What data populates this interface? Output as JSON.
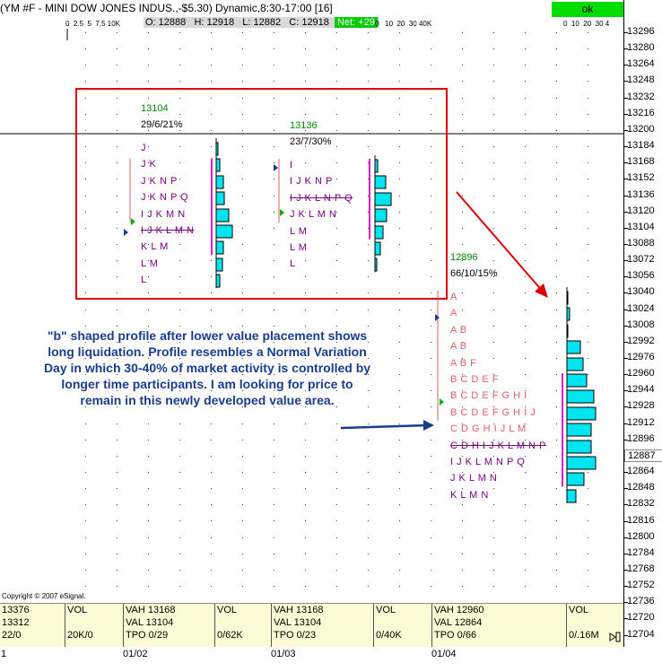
{
  "window": {
    "title": "(YM #F - MINI DOW JONES INDUS.,-$5.30) Dynamic,8:30-17:00 [16]",
    "ok_label": "ok"
  },
  "quote_bar": {
    "open": "O: 12888",
    "high": "H: 12918",
    "low": "L: 12882",
    "close": "C: 12918",
    "net": "Net: +29"
  },
  "vol_scales": {
    "left": [
      "0",
      "2.5",
      "5",
      "7.5",
      "10K"
    ],
    "mid": [
      "0",
      "10",
      "20",
      "30",
      "40K"
    ],
    "right": [
      "0",
      "10",
      "20",
      "30",
      "4"
    ]
  },
  "price_axis": {
    "labels": [
      "13296",
      "13280",
      "13264",
      "13248",
      "13232",
      "13216",
      "13200",
      "13184",
      "13168",
      "13152",
      "13136",
      "13120",
      "13104",
      "13088",
      "13072",
      "13056",
      "13040",
      "13024",
      "13008",
      "12992",
      "12976",
      "12960",
      "12944",
      "12928",
      "12912",
      "12896",
      "12880",
      "12864",
      "12848",
      "12832",
      "12816",
      "12800",
      "12784",
      "12768",
      "12752",
      "12736",
      "12720",
      "12704"
    ],
    "current_price": "12887"
  },
  "profiles": [
    {
      "header_value": "13104",
      "header_stats": "29/6/21%",
      "rows": [
        "J",
        "J K",
        "J K N P",
        "J K N P Q",
        "I J K M N",
        "I J K L M N",
        "K L M",
        "L M",
        "L"
      ],
      "poc_row": 5
    },
    {
      "header_value": "13136",
      "header_stats": "23/7/30%",
      "rows": [
        "I",
        "I J K N P",
        "I J K L N P Q",
        "J K L M N",
        "L M",
        "L M",
        "L"
      ],
      "poc_row": 2
    },
    {
      "header_value": "12896",
      "header_stats": "66/10/15%",
      "rows": [
        "A",
        "A",
        "A B",
        "A B",
        "A B F",
        "B C D E F",
        "B C D E F G H I",
        "B C D E F G H I J",
        "C D G H I J L M",
        "C D H I J K L M N P",
        "I J K L M N P Q",
        "J K L M N",
        "K L M N"
      ],
      "poc_row": 9
    }
  ],
  "annotation": "\"b\" shaped profile after lower value placement shows long liquidation. Profile resembles a Normal Variation Day in which 30-40% of market activity is controlled by longer time participants. I am looking for price to remain in this newly developed value area.",
  "footer": {
    "left_stats": [
      "13376",
      "13312",
      "22/0"
    ],
    "cells": [
      {
        "vol_label": "VOL",
        "vol_value": "20K/0",
        "vah": "VAH 13168",
        "val": "VAL 13104",
        "tpo": "TPO 0/29"
      },
      {
        "vol_label": "VOL",
        "vol_value": "0/62K",
        "vah": "VAH 13168",
        "val": "VAL 13104",
        "tpo": "TPO 0/23"
      },
      {
        "vol_label": "VOL",
        "vol_value": "0/40K",
        "vah": "VAH 12960",
        "val": "VAL 12864",
        "tpo": "TPO 0/66"
      },
      {
        "vol_label": "VOL",
        "vol_value": "0/.16M"
      }
    ]
  },
  "dates": [
    "1",
    "01/02",
    "01/03",
    "01/04"
  ],
  "copyright": "Copyright © 2007 eSignal.",
  "colors": {
    "annotation_box": "#e00000",
    "arrow_red": "#e00000",
    "arrow_blue": "#1a3c8f",
    "profile_tpo": "#7a0080",
    "profile_tpo_early": "#e06060",
    "volume_bar": "#00e5f0",
    "value_area_line": "#e020c8"
  }
}
